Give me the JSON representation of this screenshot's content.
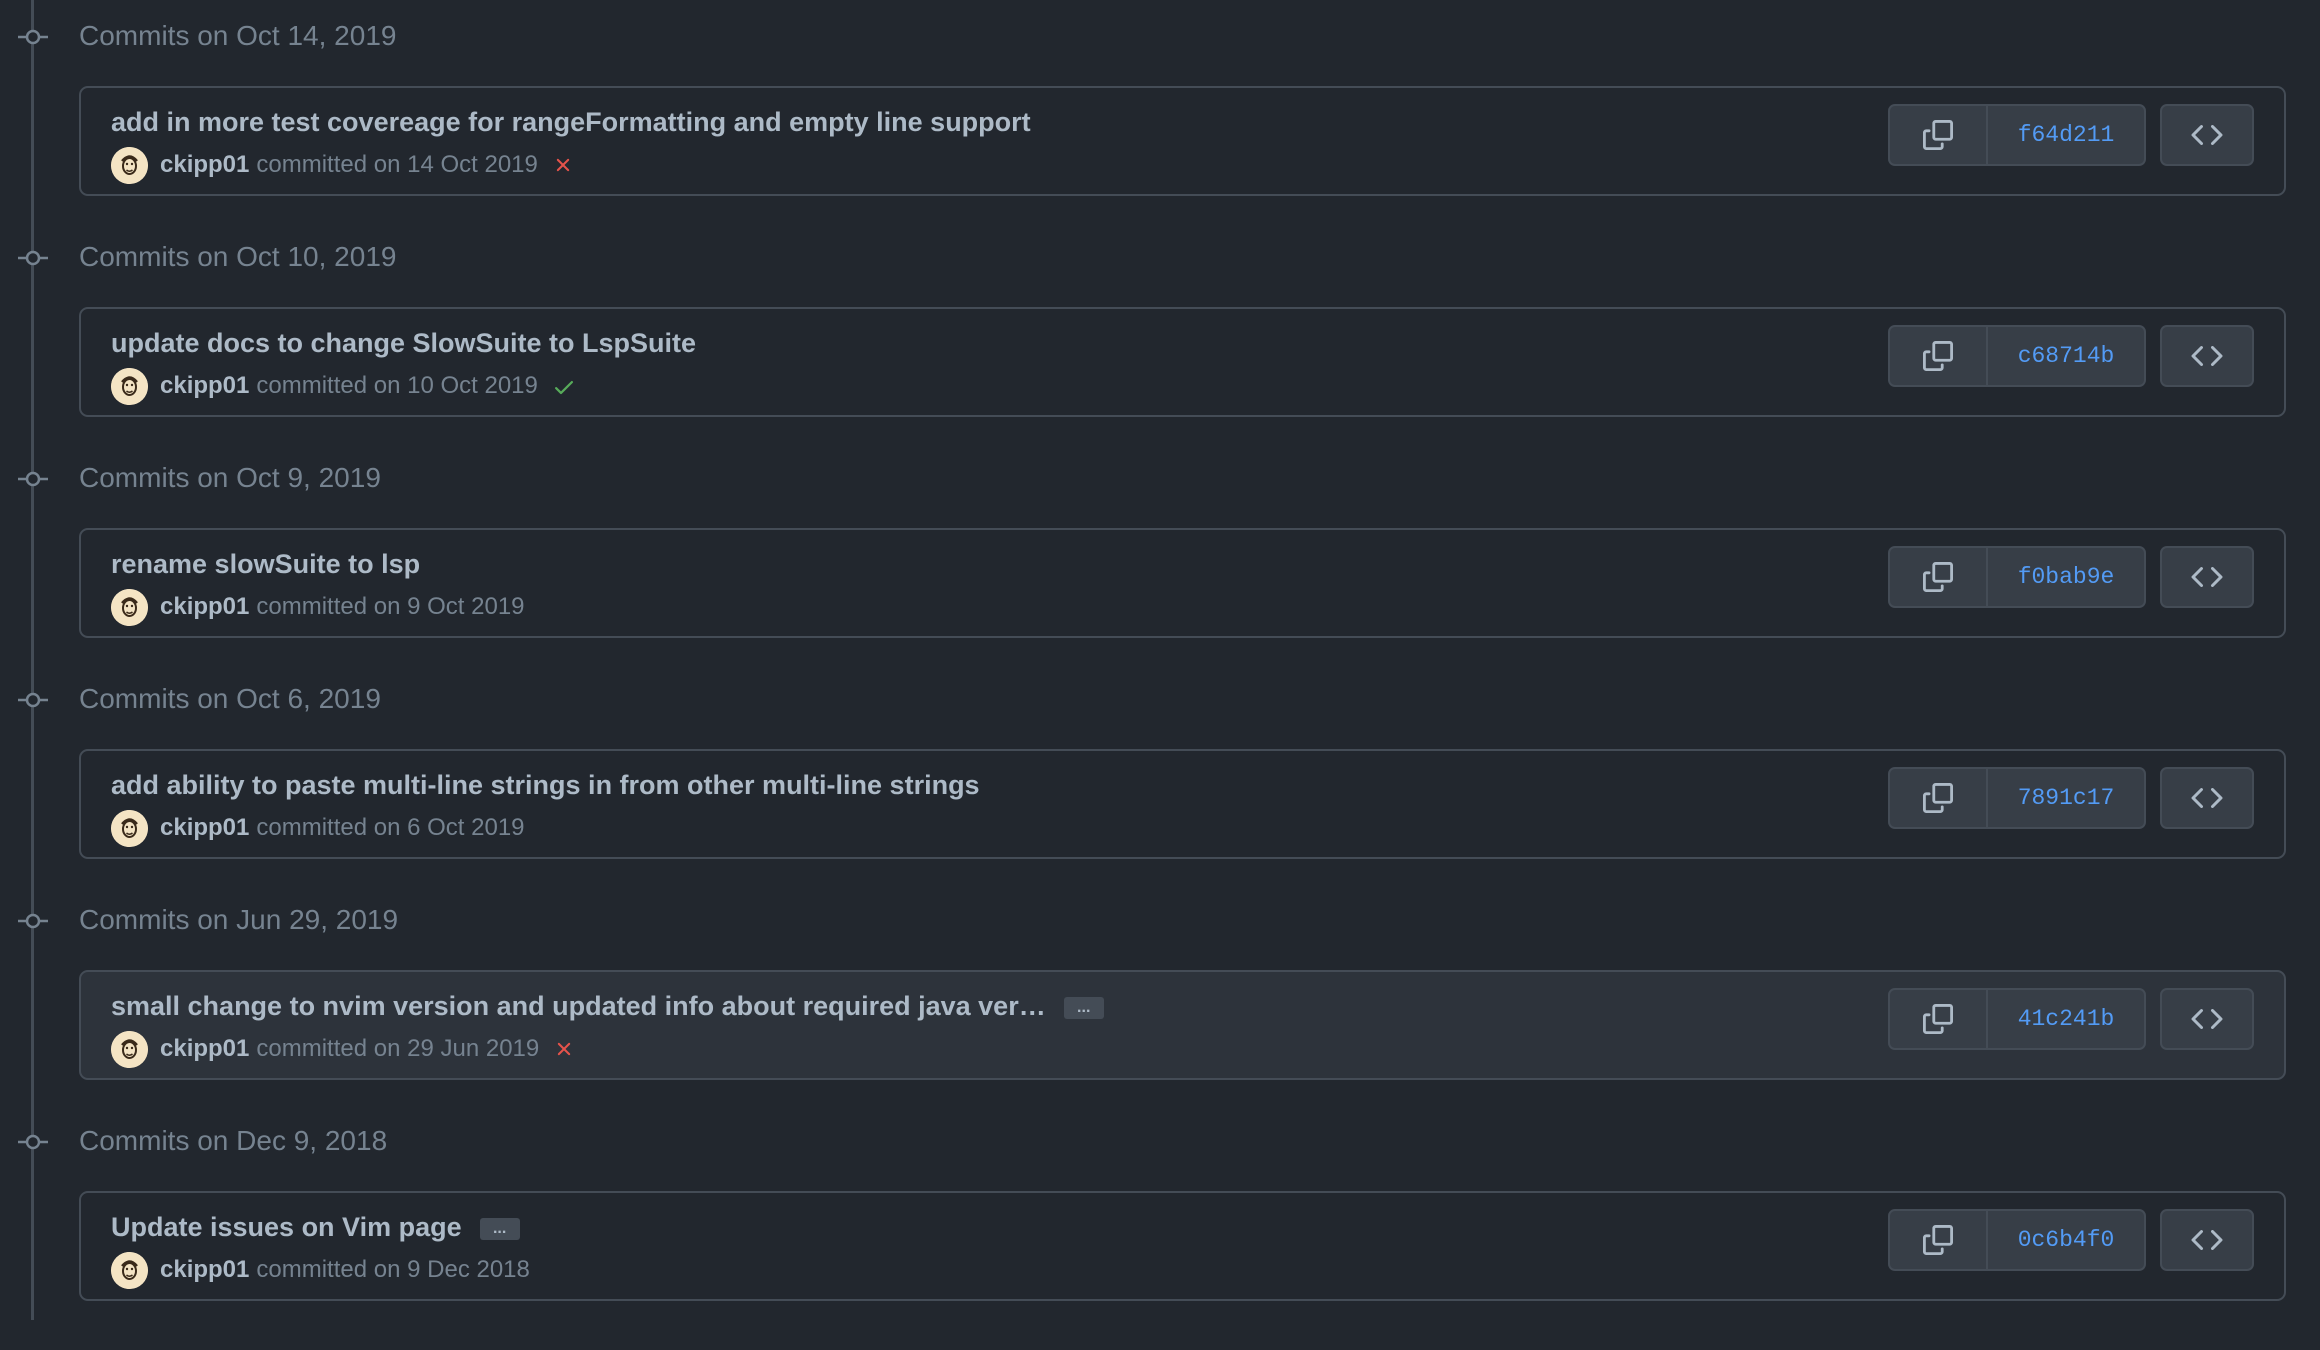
{
  "groups": [
    {
      "date": "Commits on Oct 14, 2019",
      "commit": {
        "message": "add in more test covereage for rangeFormatting and empty line support",
        "has_ellipsis": false,
        "author": "ckipp01",
        "committed": "committed on 14 Oct 2019",
        "status": "failure",
        "sha": "f64d211",
        "highlighted": false
      }
    },
    {
      "date": "Commits on Oct 10, 2019",
      "commit": {
        "message": "update docs to change SlowSuite to LspSuite",
        "has_ellipsis": false,
        "author": "ckipp01",
        "committed": "committed on 10 Oct 2019",
        "status": "success",
        "sha": "c68714b",
        "highlighted": false
      }
    },
    {
      "date": "Commits on Oct 9, 2019",
      "commit": {
        "message": "rename slowSuite to lsp",
        "has_ellipsis": false,
        "author": "ckipp01",
        "committed": "committed on 9 Oct 2019",
        "status": "none",
        "sha": "f0bab9e",
        "highlighted": false
      }
    },
    {
      "date": "Commits on Oct 6, 2019",
      "commit": {
        "message": "add ability to paste multi-line strings in from other multi-line strings",
        "has_ellipsis": false,
        "author": "ckipp01",
        "committed": "committed on 6 Oct 2019",
        "status": "none",
        "sha": "7891c17",
        "highlighted": false
      }
    },
    {
      "date": "Commits on Jun 29, 2019",
      "commit": {
        "message": "small change to nvim version and updated info about required java ver…",
        "has_ellipsis": true,
        "author": "ckipp01",
        "committed": "committed on 29 Jun 2019",
        "status": "failure",
        "sha": "41c241b",
        "highlighted": true
      }
    },
    {
      "date": "Commits on Dec 9, 2018",
      "commit": {
        "message": "Update issues on Vim page",
        "has_ellipsis": true,
        "author": "ckipp01",
        "committed": "committed on 9 Dec 2018",
        "status": "none",
        "sha": "0c6b4f0",
        "highlighted": false
      }
    }
  ],
  "icons": {
    "commit": "git-commit-icon",
    "copy": "copy-icon",
    "browse": "code-icon",
    "failure": "x-icon",
    "success": "check-icon",
    "ellipsis": "..."
  },
  "colors": {
    "background": "#22272e",
    "border": "#444c56",
    "sha_link": "#539bf5",
    "failure": "#e5534b",
    "success": "#57ab5a",
    "muted_text": "#768390",
    "primary_text": "#adbac7"
  }
}
